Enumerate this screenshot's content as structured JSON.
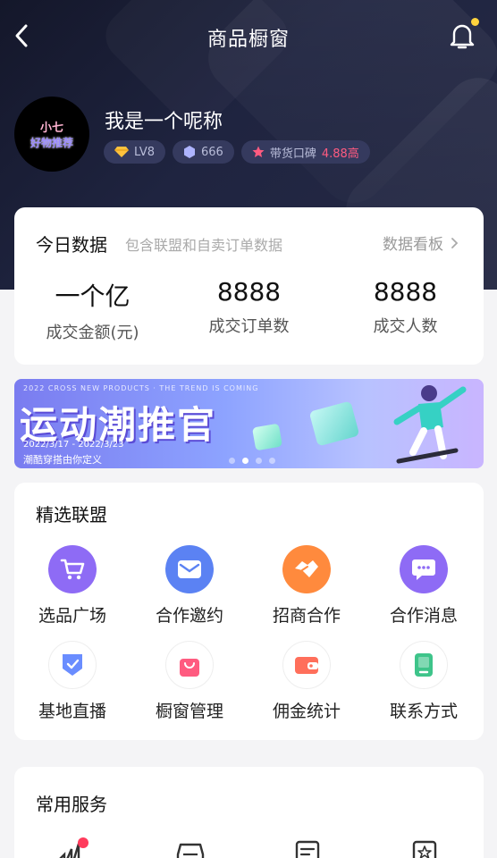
{
  "header": {
    "title": "商品橱窗"
  },
  "profile": {
    "avatar_line1": "小七",
    "avatar_line2": "好物推荐",
    "nickname": "我是一个呢称",
    "level": "LV8",
    "fans": "666",
    "reputation_label": "带货口碑",
    "reputation_value": "4.88高"
  },
  "today": {
    "title": "今日数据",
    "subtitle": "包含联盟和自卖订单数据",
    "link": "数据看板",
    "stats": [
      {
        "value": "一个亿",
        "label": "成交金额(元)"
      },
      {
        "value": "8888",
        "label": "成交订单数"
      },
      {
        "value": "8888",
        "label": "成交人数"
      }
    ]
  },
  "banner": {
    "topline": "2022 CROSS NEW PRODUCTS · THE TREND IS COMING",
    "headline": "运动潮推官",
    "dates": "2022/3/17 - 2022/3/23",
    "slogan": "潮酷穿搭由你定义",
    "active_slide": 2,
    "slide_count": 4
  },
  "alliance": {
    "title": "精选联盟",
    "items": [
      {
        "label": "选品广场",
        "icon": "cart-icon",
        "color": "#8e6bf5"
      },
      {
        "label": "合作邀约",
        "icon": "mail-icon",
        "color": "#5b82f3"
      },
      {
        "label": "招商合作",
        "icon": "handshake-icon",
        "color": "#ff8a3d"
      },
      {
        "label": "合作消息",
        "icon": "message-icon",
        "color": "#8e6bf5"
      },
      {
        "label": "基地直播",
        "icon": "shield-check-icon",
        "color": "#6a8dff"
      },
      {
        "label": "橱窗管理",
        "icon": "bag-icon",
        "color": "#ff5b80"
      },
      {
        "label": "佣金统计",
        "icon": "wallet-icon",
        "color": "#ff6f5b"
      },
      {
        "label": "联系方式",
        "icon": "phone-icon",
        "color": "#3ec48a"
      }
    ]
  },
  "services": {
    "title": "常用服务"
  },
  "colors": {
    "accent_pink": "#ff5b80",
    "notification_dot": "#ffd33d",
    "hero_bg": "#1c2038"
  }
}
